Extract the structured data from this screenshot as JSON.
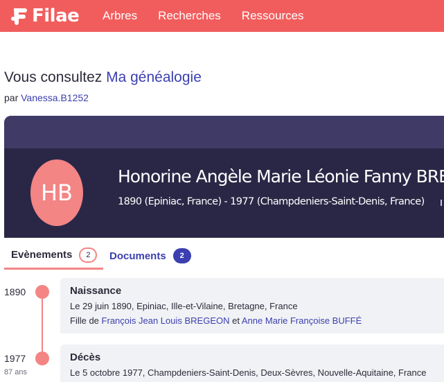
{
  "nav": {
    "logo_text": "Filae",
    "items": [
      "Arbres",
      "Recherches",
      "Ressources"
    ]
  },
  "header": {
    "consult_prefix": "Vous consultez",
    "tree_name": "Ma généalogie",
    "by_prefix": "par",
    "author": "Vanessa.B1252"
  },
  "person": {
    "initials": "HB",
    "name": "Honorine Angèle Marie Léonie Fanny BREGEON",
    "dates": "1890 (Epiniac, France) - 1977 (Champdeniers-Saint-Denis, France)"
  },
  "tabs": [
    {
      "label": "Evènements",
      "count": "2"
    },
    {
      "label": "Documents",
      "count": "2"
    }
  ],
  "events": [
    {
      "year": "1890",
      "age": "",
      "title": "Naissance",
      "detail": "Le 29 juin 1890, Epiniac, Ille-et-Vilaine, Bretagne, France",
      "parents_prefix": "Fille de",
      "father": "François Jean Louis BREGEON",
      "parents_conj": "et",
      "mother": "Anne Marie Françoise BUFFÉ"
    },
    {
      "year": "1977",
      "age": "87 ans",
      "title": "Décès",
      "detail": "Le 5 octobre 1977, Champdeniers-Saint-Denis, Deux-Sèvres, Nouvelle-Aquitaine, France"
    }
  ],
  "colors": {
    "brand": "#f15d5d",
    "link": "#3b3fb0",
    "banner": "#2a2746",
    "accent": "#f38585"
  }
}
